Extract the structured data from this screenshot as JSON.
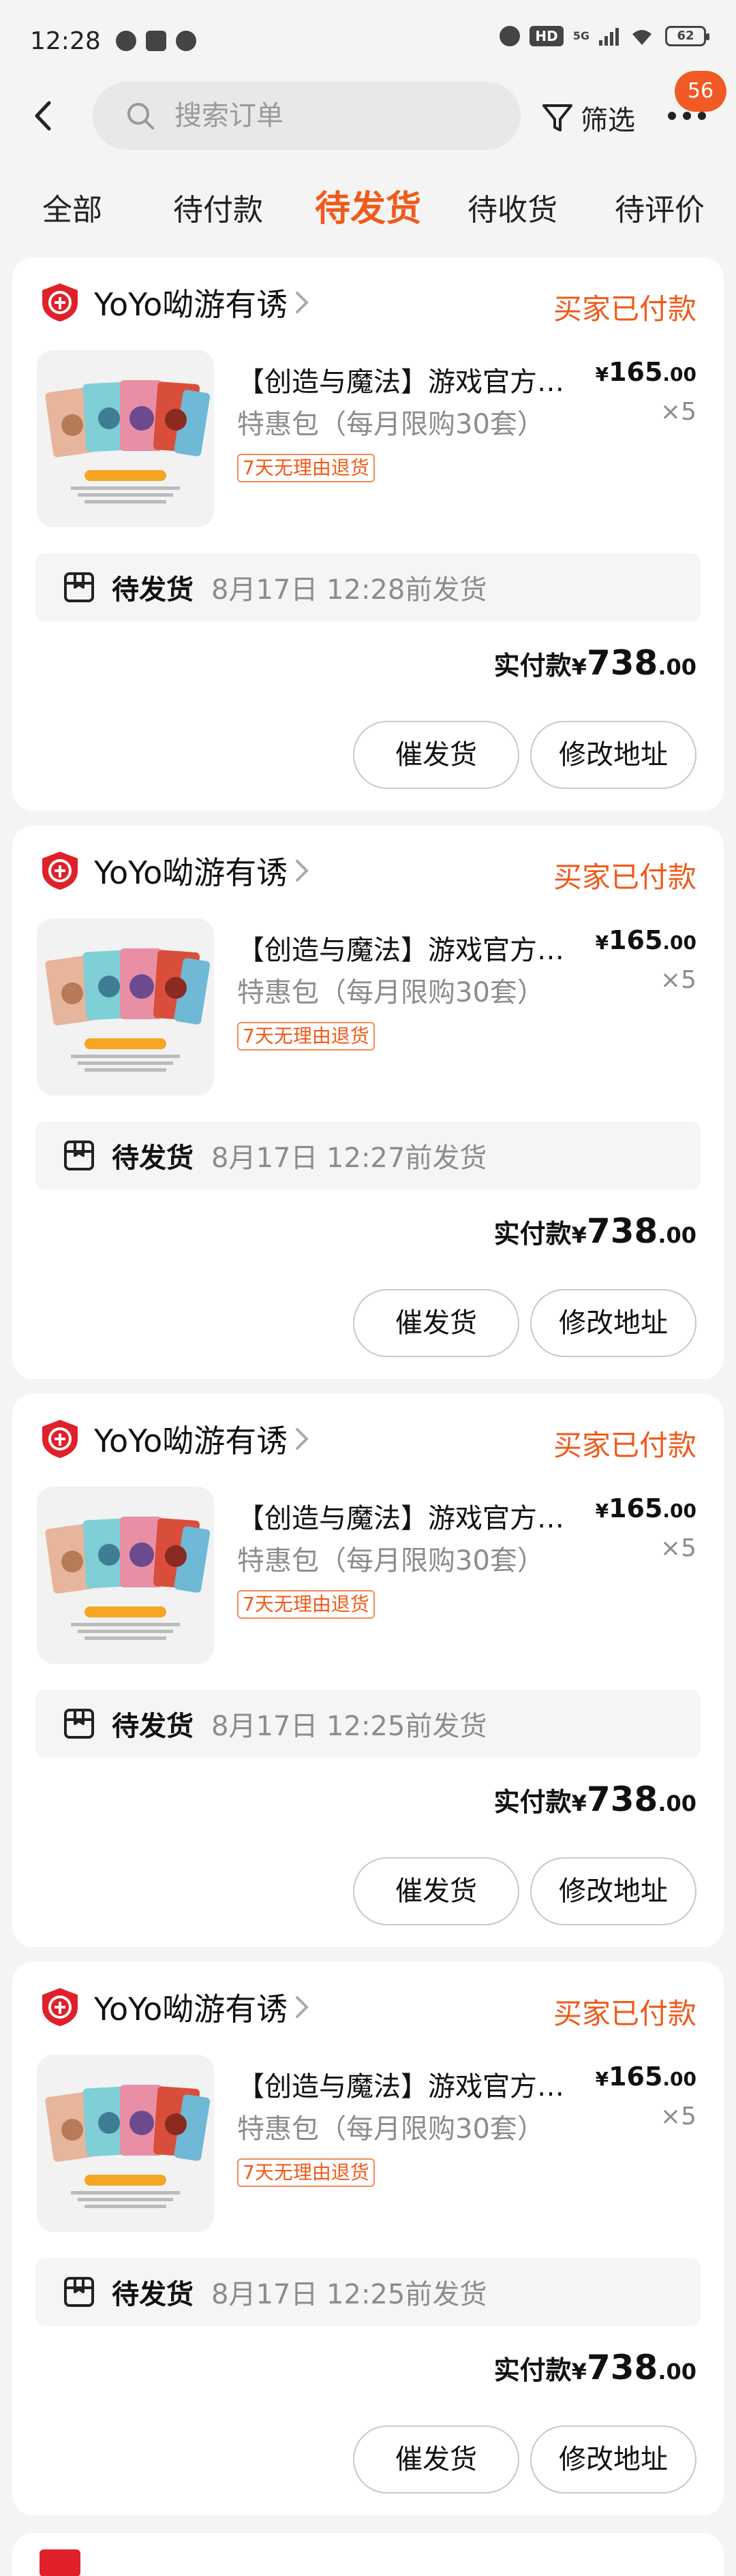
{
  "status_bar": {
    "time": "12:28",
    "network": "5G",
    "battery": "62"
  },
  "header": {
    "search_placeholder": "搜索订单",
    "filter_label": "筛选",
    "message_badge": "56"
  },
  "tabs": [
    {
      "label": "全部",
      "active": false
    },
    {
      "label": "待付款",
      "active": false
    },
    {
      "label": "待发货",
      "active": true
    },
    {
      "label": "待收货",
      "active": false
    },
    {
      "label": "待评价",
      "active": false
    }
  ],
  "orders": [
    {
      "shop_name": "YoYo呦游有诱",
      "status": "买家已付款",
      "product_title": "【创造与魔法】游戏官方桌游卡牌",
      "product_spec": "特惠包（每月限购30套）",
      "return_policy": "7天无理由退货",
      "price_currency": "¥",
      "price_int": "165",
      "price_dec": ".00",
      "quantity": "×5",
      "ship_label": "待发货",
      "ship_deadline": "8月17日 12:28前发货",
      "paid_label": "实付款",
      "paid_currency": "¥",
      "paid_int": "738",
      "paid_dec": ".00",
      "btn_urge": "催发货",
      "btn_address": "修改地址"
    },
    {
      "shop_name": "YoYo呦游有诱",
      "status": "买家已付款",
      "product_title": "【创造与魔法】游戏官方桌游卡牌",
      "product_spec": "特惠包（每月限购30套）",
      "return_policy": "7天无理由退货",
      "price_currency": "¥",
      "price_int": "165",
      "price_dec": ".00",
      "quantity": "×5",
      "ship_label": "待发货",
      "ship_deadline": "8月17日 12:27前发货",
      "paid_label": "实付款",
      "paid_currency": "¥",
      "paid_int": "738",
      "paid_dec": ".00",
      "btn_urge": "催发货",
      "btn_address": "修改地址"
    },
    {
      "shop_name": "YoYo呦游有诱",
      "status": "买家已付款",
      "product_title": "【创造与魔法】游戏官方桌游卡牌",
      "product_spec": "特惠包（每月限购30套）",
      "return_policy": "7天无理由退货",
      "price_currency": "¥",
      "price_int": "165",
      "price_dec": ".00",
      "quantity": "×5",
      "ship_label": "待发货",
      "ship_deadline": "8月17日 12:25前发货",
      "paid_label": "实付款",
      "paid_currency": "¥",
      "paid_int": "738",
      "paid_dec": ".00",
      "btn_urge": "催发货",
      "btn_address": "修改地址"
    },
    {
      "shop_name": "YoYo呦游有诱",
      "status": "买家已付款",
      "product_title": "【创造与魔法】游戏官方桌游卡牌",
      "product_spec": "特惠包（每月限购30套）",
      "return_policy": "7天无理由退货",
      "price_currency": "¥",
      "price_int": "165",
      "price_dec": ".00",
      "quantity": "×5",
      "ship_label": "待发货",
      "ship_deadline": "8月17日 12:25前发货",
      "paid_label": "实付款",
      "paid_currency": "¥",
      "paid_int": "738",
      "paid_dec": ".00",
      "btn_urge": "催发货",
      "btn_address": "修改地址"
    }
  ],
  "colors": {
    "accent": "#f05a1a",
    "shop_icon": "#e0202a",
    "background": "#f4f4f4"
  },
  "icons": [
    "back-icon",
    "search-icon",
    "filter-icon",
    "more-icon",
    "shop-badge-icon",
    "chevron-right-icon",
    "package-box-icon"
  ]
}
